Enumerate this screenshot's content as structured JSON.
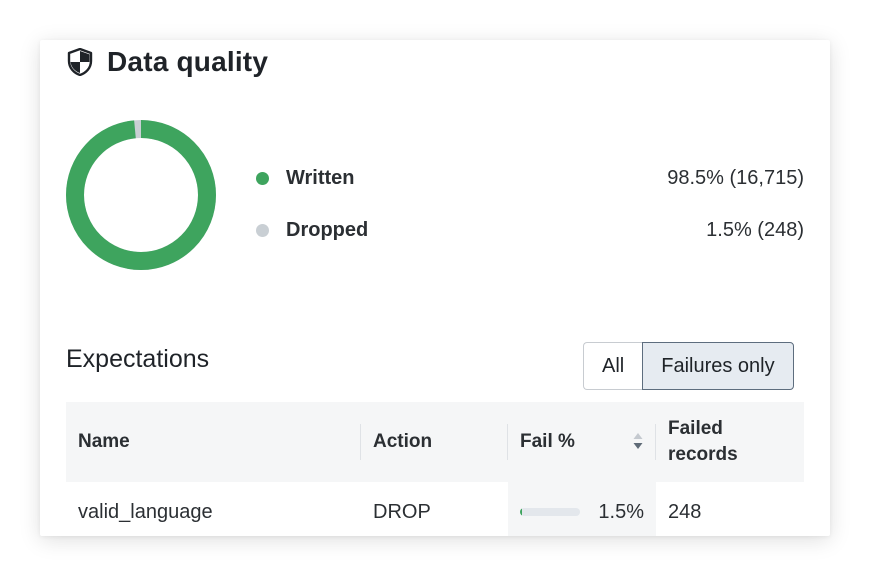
{
  "panel": {
    "title": "Data quality",
    "icon": "shield-icon"
  },
  "summary": {
    "chart": {
      "written_fraction": 0.985,
      "dropped_fraction": 0.015
    },
    "legend": [
      {
        "label": "Written",
        "value": "98.5% (16,715)",
        "color": "#3ea45e"
      },
      {
        "label": "Dropped",
        "value": "1.5% (248)",
        "color": "#c9cfd4"
      }
    ]
  },
  "expectations": {
    "title": "Expectations",
    "filter": {
      "options": [
        "All",
        "Failures only"
      ],
      "selected": "Failures only"
    },
    "table": {
      "columns": [
        "Name",
        "Action",
        "Fail %",
        "Failed\nrecords"
      ],
      "rows": [
        {
          "name": "valid_language",
          "action": "DROP",
          "fail_pct": "1.5%",
          "fail_fraction": 0.015,
          "failed_records": "248"
        }
      ]
    }
  },
  "colors": {
    "accent_green": "#3ea45e",
    "muted_gray": "#c9cfd4",
    "header_bg": "#f5f6f7"
  }
}
